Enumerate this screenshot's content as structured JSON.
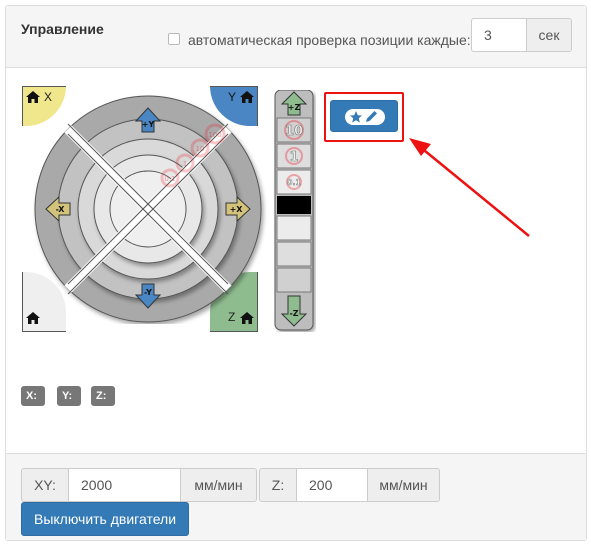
{
  "panel": {
    "title": "Управление",
    "auto_check": {
      "label": "автоматическая проверка позиции каждые:",
      "interval_value": "3",
      "unit": "сек",
      "checked": false
    }
  },
  "jog": {
    "corners": {
      "home_x": "X",
      "home_y": "Y",
      "home_z": "Z"
    },
    "arrows": {
      "plus_y": "+Y",
      "minus_y": "-Y",
      "plus_x": "+X",
      "minus_x": "-X",
      "plus_z": "+Z",
      "minus_z": "-Z"
    },
    "xy_step_labels": [
      "0.1",
      "1",
      "10",
      "100"
    ],
    "z_step_labels": [
      "10",
      "1",
      "0.1"
    ],
    "colors": {
      "x_corner": "#f0e68c",
      "y_corner": "#4a86c4",
      "z_corner": "#8fbc8f",
      "home_all": "#efefef",
      "ring_outer": "#a9a9a9",
      "ring_mid": "#c2c2c2",
      "ring_inner": "#d9d9d9",
      "center": "#efefef",
      "arrow_x": "#d2c27a",
      "arrow_y": "#4a86c4",
      "arrow_z": "#8fbc8f",
      "highlight": "#e8202a"
    }
  },
  "edit_button": {
    "icons": [
      "star-icon",
      "pencil-icon"
    ],
    "highlighted": true
  },
  "position": {
    "x_label": "X:",
    "y_label": "Y:",
    "z_label": "Z:"
  },
  "footer": {
    "xy_feed": {
      "label": "XY:",
      "value": "2000",
      "unit": "мм/мин"
    },
    "z_feed": {
      "label": "Z:",
      "value": "200",
      "unit": "мм/мин"
    },
    "motors_off_label": "Выключить двигатели"
  }
}
